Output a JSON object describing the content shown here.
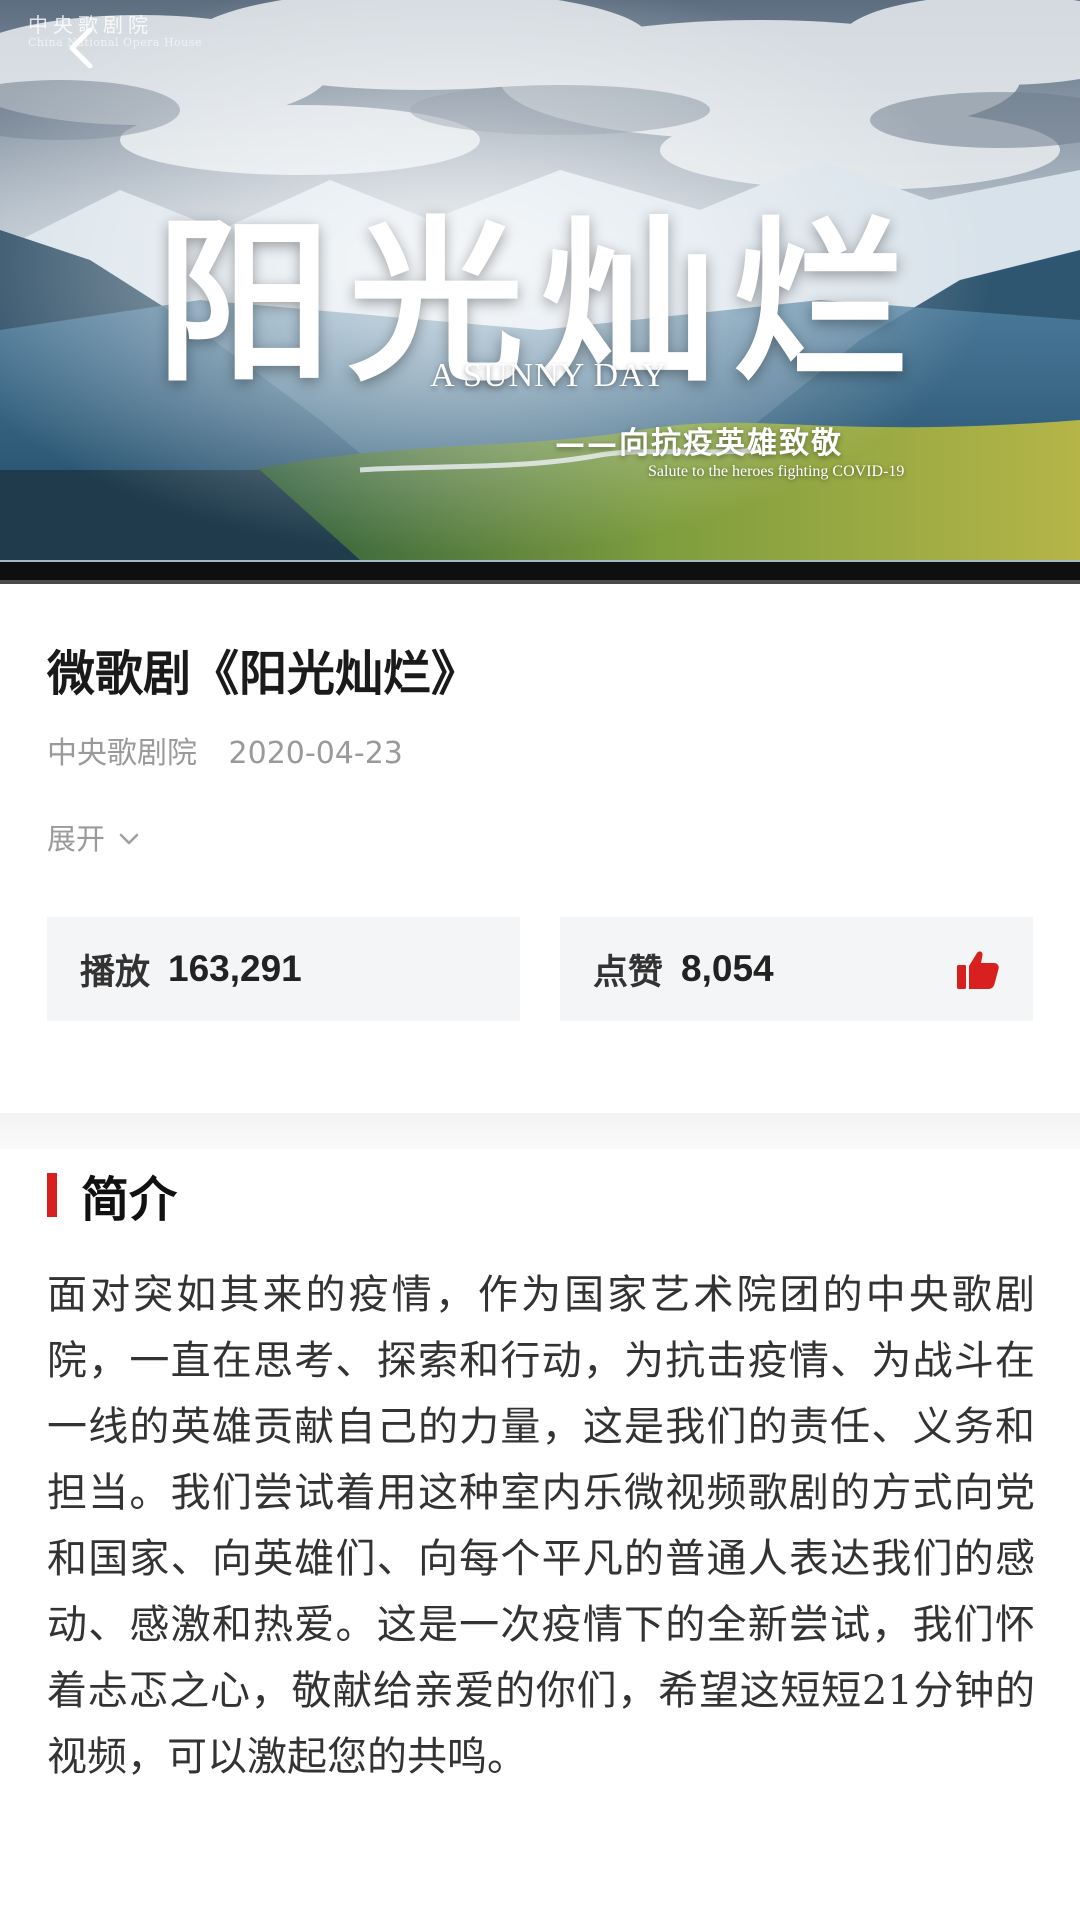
{
  "video": {
    "logo_cn": "中央歌剧院",
    "logo_en": "China National Opera House",
    "title_cn": "阳光灿烂",
    "title_en": "A SUNNY DAY",
    "subtitle_cn": "——向抗疫英雄致敬",
    "subtitle_en": "Salute to the heroes fighting COVID-19",
    "progress": 0.0,
    "back_icon": "chevron-left-icon"
  },
  "info": {
    "title": "微歌剧《阳光灿烂》",
    "publisher": "中央歌剧院",
    "date": "2020-04-23",
    "expand_label": "展开",
    "expand_icon": "chevron-down-icon"
  },
  "stats": {
    "plays_label": "播放",
    "plays_value": "163,291",
    "likes_label": "点赞",
    "likes_value": "8,054",
    "like_icon": "thumbs-up-icon",
    "accent_color": "#d8211f"
  },
  "intro": {
    "heading": "简介",
    "body": "面对突如其来的疫情，作为国家艺术院团的中央歌剧院，一直在思考、探索和行动，为抗击疫情、为战斗在一线的英雄贡献自己的力量，这是我们的责任、义务和担当。我们尝试着用这种室内乐微视频歌剧的方式向党和国家、向英雄们、向每个平凡的普通人表达我们的感动、感激和热爱。这是一次疫情下的全新尝试，我们怀着忐忑之心，敬献给亲爱的你们，希望这短短21分钟的视频，可以激起您的共鸣。"
  }
}
